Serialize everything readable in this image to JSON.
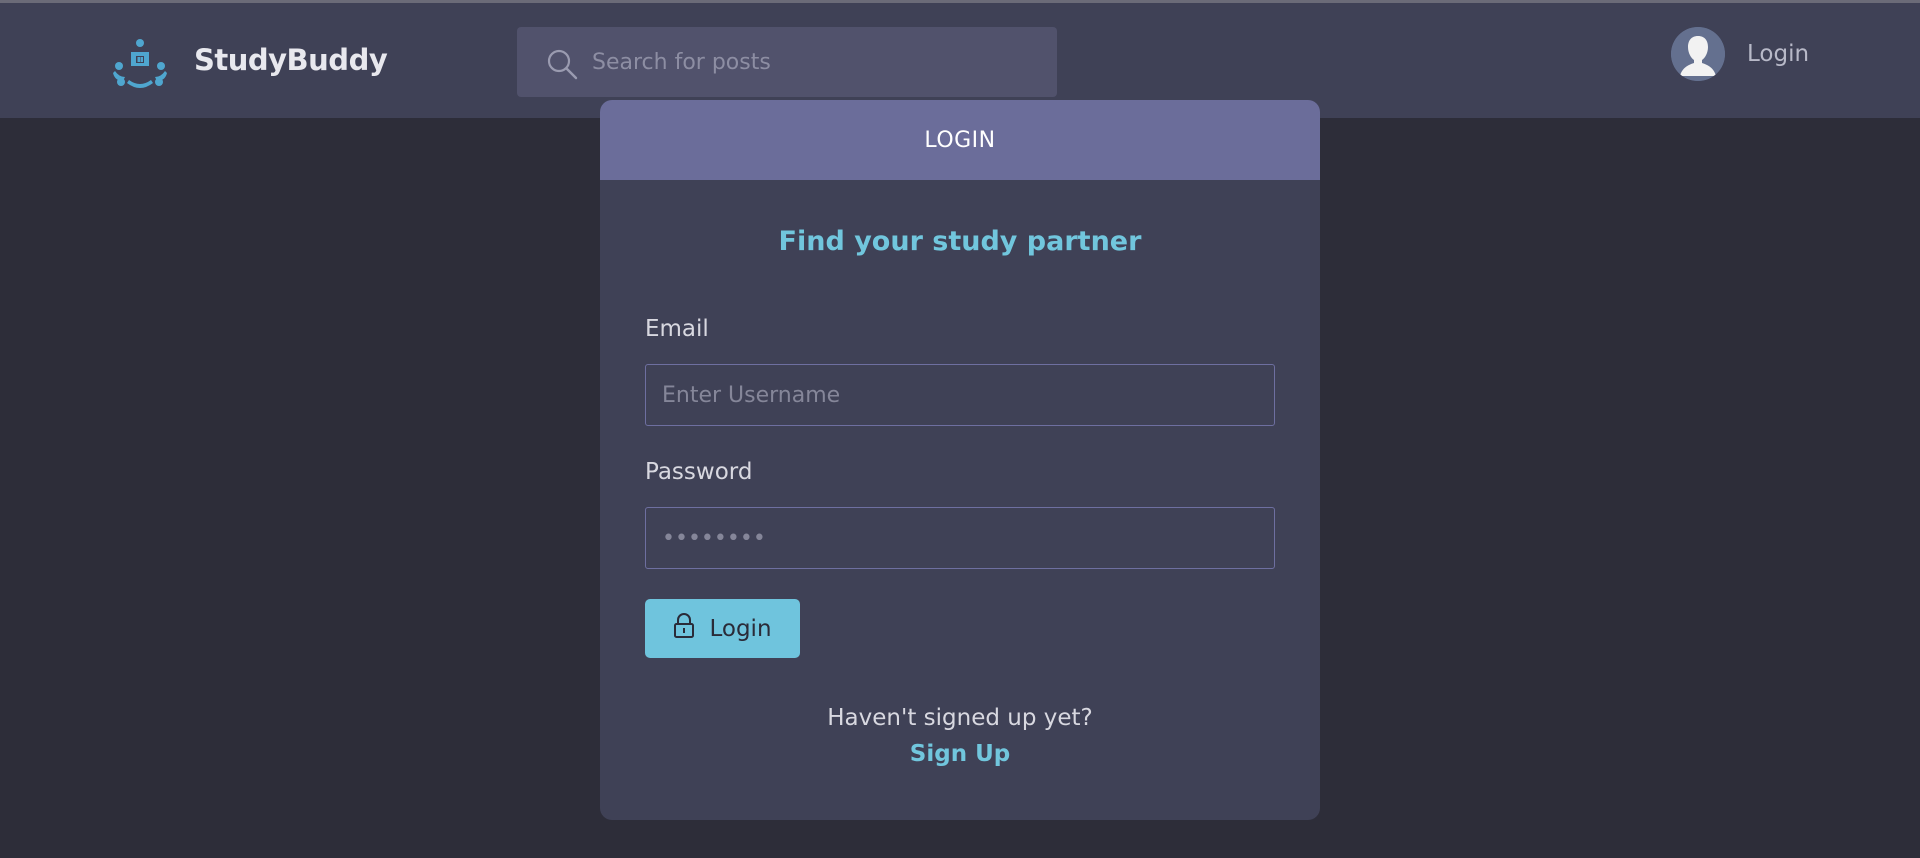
{
  "header": {
    "brand": "StudyBuddy",
    "search_placeholder": "Search for posts",
    "login_label": "Login"
  },
  "card": {
    "title": "LOGIN",
    "tagline": "Find your study partner",
    "email_label": "Email",
    "email_placeholder": "Enter Username",
    "password_label": "Password",
    "password_placeholder": "••••••••",
    "login_button": "Login",
    "signup_prompt": "Haven't signed up yet?",
    "signup_link": "Sign Up"
  },
  "icons": {
    "logo": "group-logo-icon",
    "search": "search-icon",
    "avatar": "user-avatar-icon",
    "lock": "lock-icon"
  },
  "colors": {
    "accent": "#71c6dd",
    "header_bg": "#3f4156",
    "card_header_bg": "#6b6d9a",
    "page_bg": "#2d2d39"
  }
}
